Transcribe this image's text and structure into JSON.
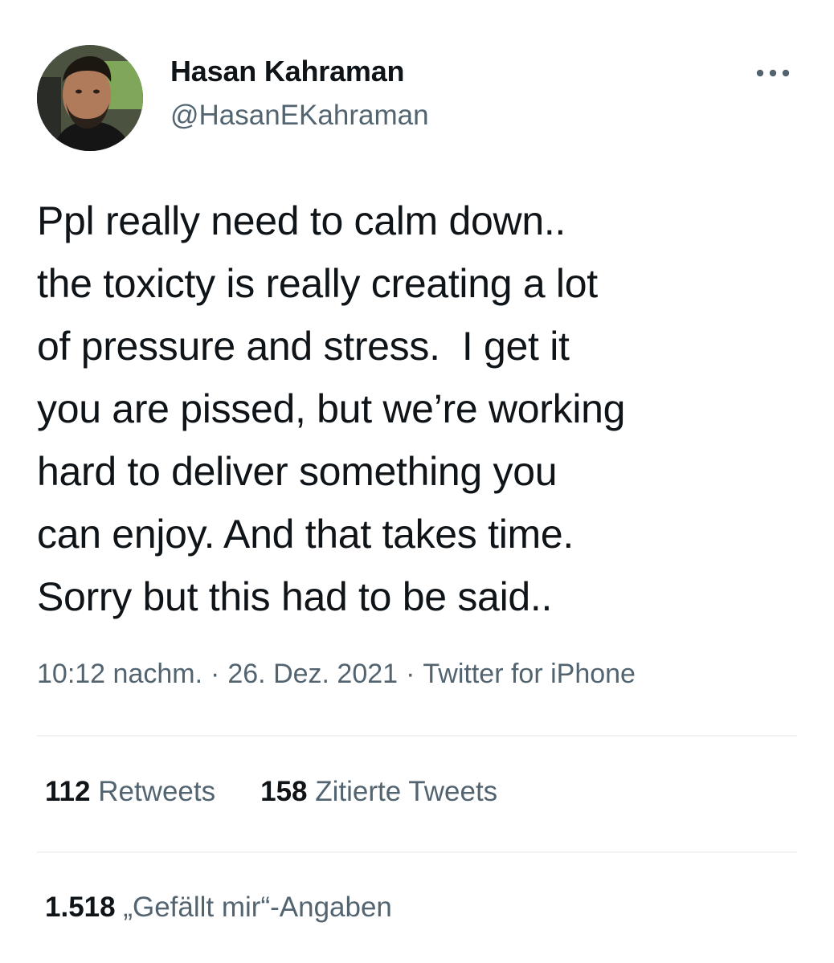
{
  "author": {
    "display_name": "Hasan Kahraman",
    "handle": "@HasanEKahraman"
  },
  "tweet": {
    "text": "Ppl really need to calm down..\nthe toxicty is really creating a lot\nof pressure and stress.  I get it\nyou are pissed, but we’re working\nhard to deliver something you\ncan enjoy. And that takes time.\nSorry but this had to be said..",
    "time": "10:12 nachm.",
    "separator": "·",
    "date": "26. Dez. 2021",
    "source": "Twitter for iPhone"
  },
  "stats": {
    "retweets": {
      "count": "112",
      "label": "Retweets"
    },
    "quotes": {
      "count": "158",
      "label": "Zitierte Tweets"
    },
    "likes": {
      "count": "1.518",
      "label": "„Gefällt mir“-Angaben"
    }
  },
  "icons": {
    "more": "more-horizontal-icon"
  },
  "colors": {
    "text_primary": "#0f1419",
    "text_secondary": "#536471",
    "divider": "#eff3f4"
  }
}
